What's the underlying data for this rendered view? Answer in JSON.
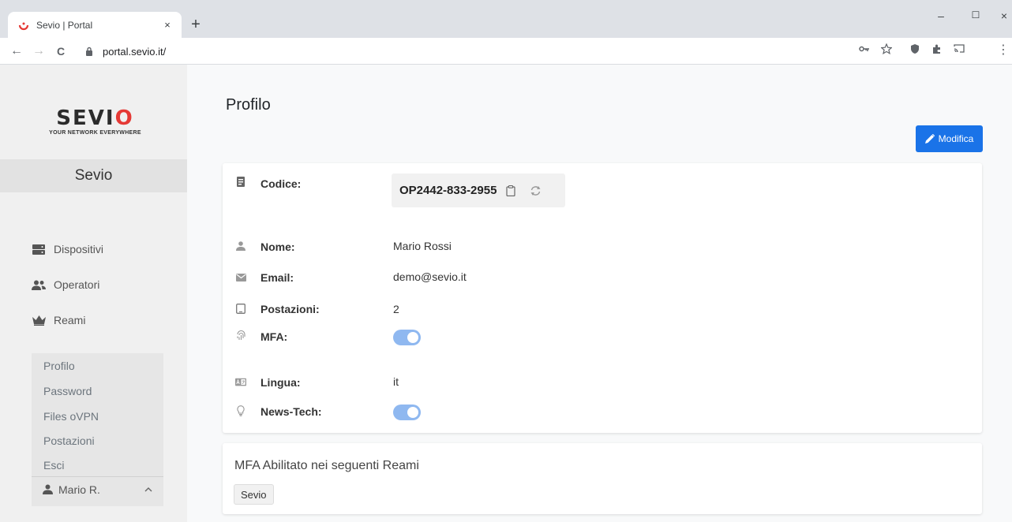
{
  "browser": {
    "tab_title": "Sevio | Portal",
    "tab_close": "×",
    "new_tab": "+",
    "url": "portal.sevio.it/",
    "win_minimize": "–",
    "win_maximize": "☐",
    "win_close": "×",
    "back": "←",
    "forward": "→",
    "reload": "C",
    "menu": "⋮"
  },
  "sidebar": {
    "logo_text_part1": "SEVI",
    "logo_text_part2": "O",
    "logo_tagline": "YOUR NETWORK EVERYWHERE",
    "realm": "Sevio",
    "nav": [
      {
        "label": "Dispositivi",
        "icon": "server-icon"
      },
      {
        "label": "Operatori",
        "icon": "users-icon"
      },
      {
        "label": "Reami",
        "icon": "crown-icon"
      }
    ],
    "submenu": [
      "Profilo",
      "Password",
      "Files oVPN",
      "Postazioni",
      "Esci"
    ],
    "user": "Mario R."
  },
  "main": {
    "title": "Profilo",
    "edit_button": "Modifica",
    "fields": {
      "code_label": "Codice:",
      "code_value": "OP2442-833-2955",
      "name_label": "Nome:",
      "name_value": "Mario Rossi",
      "email_label": "Email:",
      "email_value": "demo@sevio.it",
      "stations_label": "Postazioni:",
      "stations_value": "2",
      "mfa_label": "MFA:",
      "language_label": "Lingua:",
      "language_value": "it",
      "newstech_label": "News-Tech:"
    },
    "mfa_enabled": true,
    "newstech_enabled": true,
    "mfa_card_title": "MFA Abilitato nei seguenti Reami",
    "mfa_realms": [
      "Sevio"
    ]
  },
  "colors": {
    "accent": "#1a73e8",
    "toggle_on": "#8fb8f0",
    "logo_red": "#e53935"
  }
}
